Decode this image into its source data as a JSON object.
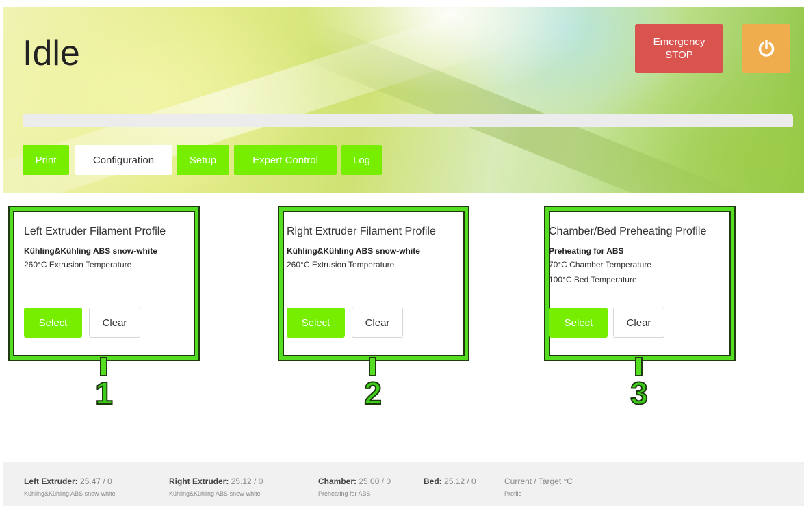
{
  "header": {
    "status": "Idle",
    "emergency_line1": "Emergency",
    "emergency_line2": "STOP",
    "progress_percent": 0,
    "tabs": [
      {
        "label": "Print",
        "active": false
      },
      {
        "label": "Configuration",
        "active": true
      },
      {
        "label": "Setup",
        "active": false
      },
      {
        "label": "Expert Control",
        "active": false
      },
      {
        "label": "Log",
        "active": false
      }
    ]
  },
  "cards": [
    {
      "title": "Left Extruder Filament Profile",
      "profile": "Kühling&Kühling ABS snow-white",
      "lines": [
        "260°C Extrusion Temperature"
      ],
      "callout": "1"
    },
    {
      "title": "Right Extruder Filament Profile",
      "profile": "Kühling&Kühling ABS snow-white",
      "lines": [
        "260°C Extrusion Temperature"
      ],
      "callout": "2"
    },
    {
      "title": "Chamber/Bed Preheating Profile",
      "profile": "Preheating for ABS",
      "lines": [
        "70°C Chamber Temperature",
        "100°C Bed Temperature"
      ],
      "callout": "3"
    }
  ],
  "buttons": {
    "select": "Select",
    "clear": "Clear"
  },
  "footer": {
    "left": {
      "label": "Left Extruder:",
      "value": "25.47 / 0",
      "sub": "Kühling&Kühling ABS snow-white"
    },
    "right": {
      "label": "Right Extruder:",
      "value": "25.12 / 0",
      "sub": "Kühling&Kühling ABS snow-white"
    },
    "chamber": {
      "label": "Chamber:",
      "value": "25.00 / 0",
      "sub": "Preheating for ABS"
    },
    "bed": {
      "label": "Bed:",
      "value": "25.12 / 0"
    },
    "legend": {
      "main": "Current / Target °C",
      "sub": "Profile"
    }
  },
  "colors": {
    "accent_green": "#77ee00",
    "emergency_red": "#d9534f",
    "power_orange": "#f0ad4e",
    "callout_green": "#55dd22"
  },
  "icons": {
    "power": "power-icon"
  }
}
